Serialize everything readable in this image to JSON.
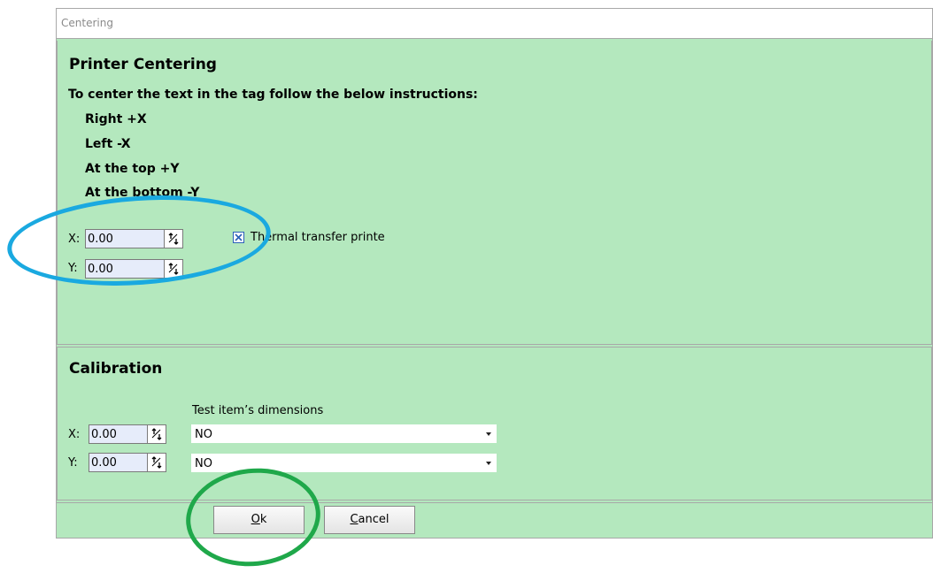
{
  "window": {
    "title": "Centering"
  },
  "printer_centering": {
    "heading": "Printer Centering",
    "instruction": "To center the text in the tag follow the below instructions:",
    "rules": [
      "Right +X",
      "Left -X",
      "At the top +Y",
      "At the bottom -Y"
    ],
    "x_label": "X:",
    "x_value": "0.00",
    "y_label": "Y:",
    "y_value": "0.00",
    "thermal_checkbox_label": "Thermal transfer printe",
    "thermal_checked": true
  },
  "calibration": {
    "heading": "Calibration",
    "dimensions_label": "Test item’s dimensions",
    "x_label": "X:",
    "x_value": "0.00",
    "y_label": "Y:",
    "y_value": "0.00",
    "x_dimension_selected": "NO",
    "y_dimension_selected": "NO"
  },
  "buttons": {
    "ok_mnemonic": "O",
    "ok_rest": "k",
    "cancel_mnemonic": "C",
    "cancel_rest": "ancel"
  },
  "annotation_colors": {
    "blue_circle": "#1aa9e0",
    "green_circle": "#1fa84a"
  }
}
